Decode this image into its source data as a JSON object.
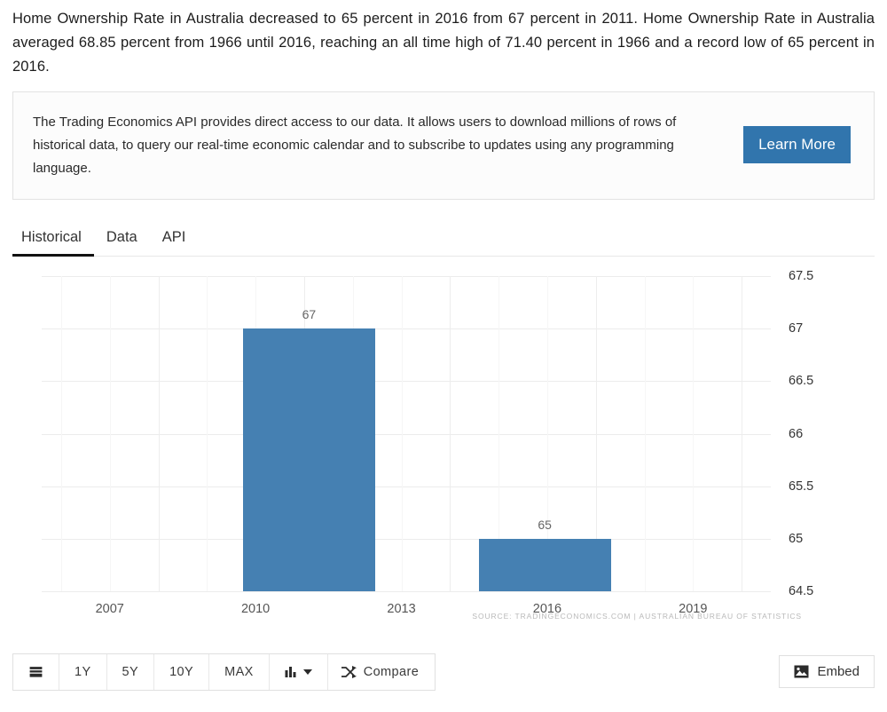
{
  "intro": {
    "paragraph": "Home Ownership Rate in Australia decreased to 65 percent in 2016 from 67 percent in 2011. Home Ownership Rate in Australia averaged 68.85 percent from 1966 until 2016, reaching an all time high of 71.40 percent in 1966 and a record low of 65 percent in 2016."
  },
  "api_promo": {
    "text": "The Trading Economics API provides direct access to our data. It allows users to download millions of rows of historical data, to query our real-time economic calendar and to subscribe to updates using any programming language.",
    "button_label": "Learn More",
    "button_color": "#3175ad"
  },
  "tabs": [
    {
      "label": "Historical",
      "active": true
    },
    {
      "label": "Data",
      "active": false
    },
    {
      "label": "API",
      "active": false
    }
  ],
  "toolbar": {
    "calendar_icon": "calendar-icon",
    "ranges": [
      "1Y",
      "5Y",
      "10Y",
      "MAX"
    ],
    "chart_type_icon": "bar-chart-icon",
    "chart_type_caret": "chevron-down-icon",
    "compare_label": "Compare",
    "compare_icon": "shuffle-icon",
    "embed_label": "Embed",
    "embed_icon": "image-icon"
  },
  "chart_data": {
    "type": "bar",
    "title": "",
    "xlabel": "",
    "ylabel": "",
    "categories": [
      "2011",
      "2016"
    ],
    "values": [
      67,
      65
    ],
    "bar_labels": [
      "67",
      "65"
    ],
    "bar_color": "#4580b2",
    "ylim": [
      64.5,
      67.5
    ],
    "y_ticks": [
      "67.5",
      "67",
      "66.5",
      "66",
      "65.5",
      "65",
      "64.5"
    ],
    "y_tick_values": [
      67.5,
      67,
      66.5,
      66,
      65.5,
      65,
      64.5
    ],
    "x_ticks": [
      "2007",
      "2010",
      "2013",
      "2016",
      "2019"
    ],
    "x_tick_values": [
      2007,
      2010,
      2013,
      2016,
      2019
    ],
    "xlim": [
      2005.6,
      2020.6
    ],
    "grid": true,
    "legend": false,
    "source": "SOURCE: TRADINGECONOMICS.COM | AUSTRALIAN BUREAU OF STATISTICS"
  }
}
